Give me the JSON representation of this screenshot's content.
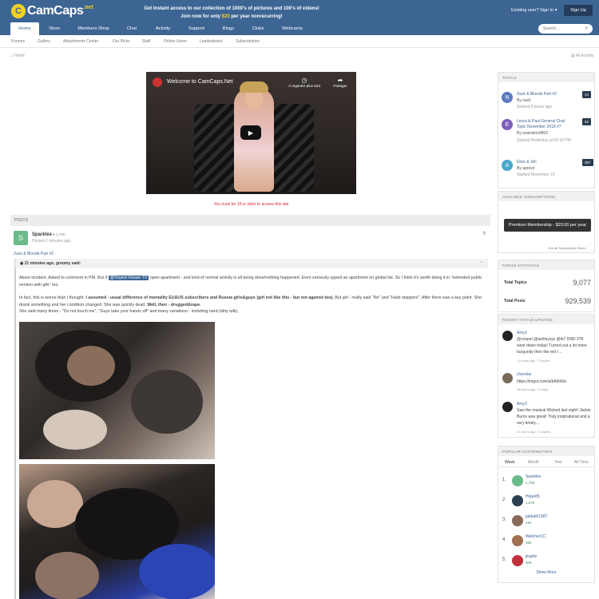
{
  "brand": {
    "name": "CamCaps",
    "suffix": ".net"
  },
  "promo": {
    "line1": "Get Instant access to our collection of 1000's of pictures and 100's of videos!",
    "line2_pre": "Join now for only ",
    "line2_price": "$20",
    "line2_post": " per year nonrecurring!"
  },
  "header": {
    "signin": "Existing user? Sign In ▾",
    "signup": "Sign Up"
  },
  "nav": {
    "items": [
      "Home",
      "Store",
      "Members Shop",
      "Chat",
      "Activity",
      "Support",
      "Blogs",
      "Clubs",
      "Webcams"
    ],
    "search_placeholder": "Search..."
  },
  "subnav": {
    "items": [
      "Forums",
      "Gallery",
      "Attachments Center",
      "Our Picks",
      "Staff",
      "Online Users",
      "Leaderboard",
      "Subscriptions"
    ]
  },
  "breadcrumb": {
    "home": "Home",
    "all_activity": "All Activity"
  },
  "video": {
    "title": "Welcome to CamCaps.Net",
    "later": "À regarder plus tard",
    "share": "Partager"
  },
  "age_note": "You must be 18 or older to access this site",
  "posts": {
    "header": "POSTS",
    "author": "Sparkles",
    "reputation": "1,790",
    "posted": "Posted 2 minutes ago",
    "topic_link": "Zack & Blonde Part #2",
    "quote_head": "21 minutes ago, groomy said:",
    "para1_pre": "About incident. Asked to comment in PM. But if ",
    "para1_tag": "@Voyeur House TV",
    "para1_post": " open apartment - and kind of normal activity is all being done/nothing happened. Even seriously upped an apartment on global list. So I think it's worth doing it in \"extended public version with gifs\" too.",
    "para2_pre": "In fact, this is worse than I thought. ",
    "para2_bold": "I assumed - usual difference of mentality EU&US subscribers and Russia girls&guys (girl not like this - but not against too).",
    "para2_mid": " But girl - really said \"No\" and \"Hard stoppers\". After there was a key point. She drank something and her condition changed. She was quickly dead. ",
    "para2_bold2": "Well, then - drugged&rape.",
    "para3": "She said many times - \"Do not touch me\", \"Guys take your hands off\" and many variations - including hard (dirty talk)."
  },
  "topics": {
    "header": "TOPICS",
    "items": [
      {
        "initial": "N",
        "color": "#5b7bbf",
        "title": "Zack & Blonde Part #2",
        "by": "By nack",
        "started": "Started 8 hours ago",
        "count": "14"
      },
      {
        "initial": "E",
        "color": "#7d5fb8",
        "title": "Leora & Paul General Chat Topic November 2018 #7",
        "by": "By esanders9863",
        "started": "Started Yesterday at 02:10 PM",
        "count": "62"
      },
      {
        "initial": "A",
        "color": "#4aa7c9",
        "title": "Elise & Jim",
        "by": "By apricot",
        "started": "Started November 19",
        "count": "367"
      }
    ]
  },
  "subscriptions": {
    "header": "AVAILABLE SUBSCRIPTIONS",
    "button": "Premium Membership - $20.00 per year",
    "see_all": "See all Subscription Plans ›"
  },
  "forum_stats": {
    "header": "FORUM STATISTICS",
    "total_topics_label": "Total Topics",
    "total_topics": "9,077",
    "total_posts_label": "Total Posts",
    "total_posts": "929,539"
  },
  "status_updates": {
    "header": "RECENT STATUS UPDATES",
    "items": [
      {
        "name": "Amy3",
        "text": "@coopel @ashleyxyz @kt7 DND 378 went down today! Turned out a lot more burgundy then the red I…",
        "meta": "11 hours ago · 3 replies",
        "color": "#222"
      },
      {
        "name": "cheroba",
        "text": "https://imgur.com/a/bAt640s",
        "meta": "18 hours ago · 1 reply",
        "color": "#7a6a5a"
      },
      {
        "name": "Amy3",
        "text": "Saw the musical Wicked last night! Jackie Burns was great! Truly inspirational and a very timely…",
        "meta": "23 hours ago · 5 replies",
        "color": "#222"
      }
    ]
  },
  "contributors": {
    "header": "POPULAR CONTRIBUTORS",
    "tabs": [
      "Week",
      "Month",
      "Year",
      "All Time"
    ],
    "items": [
      {
        "rank": "1",
        "name": "Sparkles",
        "rep": "1,790",
        "color": "#6aba8a"
      },
      {
        "rank": "2",
        "name": "Hope85",
        "rep": "1,676",
        "color": "#2c4050"
      },
      {
        "rank": "3",
        "name": "jabbath1987",
        "rep": "494",
        "color": "#8a6a5a"
      },
      {
        "rank": "4",
        "name": "WatcherCC",
        "rep": "358",
        "color": "#a07050"
      },
      {
        "rank": "5",
        "name": "jkopite",
        "rep": "305",
        "color": "#c0303a"
      }
    ],
    "show_more": "Show More"
  }
}
